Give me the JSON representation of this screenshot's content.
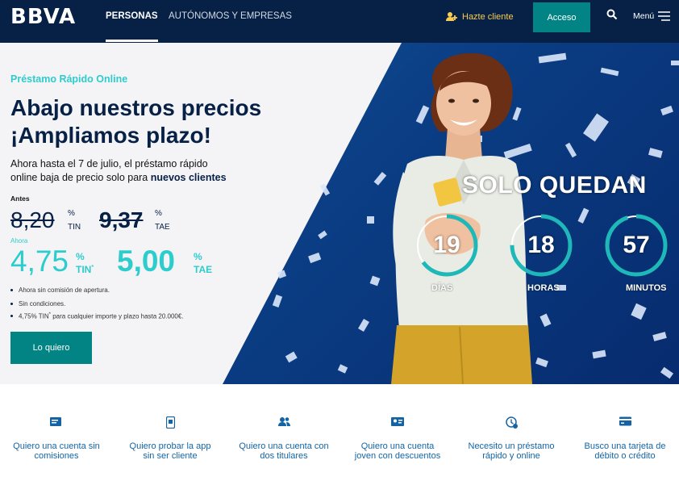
{
  "header": {
    "logo": "BBVA",
    "nav": [
      {
        "label": "PERSONAS",
        "active": true
      },
      {
        "label": "AUTÓNOMOS Y EMPRESAS",
        "active": false
      }
    ],
    "hazte_cliente": "Hazte cliente",
    "acceso": "Acceso",
    "menu": "Menú"
  },
  "hero": {
    "subtitle": "Préstamo Rápido Online",
    "title_line1": "Abajo nuestros precios",
    "title_line2": "¡Ampliamos plazo!",
    "desc_line1": "Ahora hasta el 7 de julio, el préstamo rápido",
    "desc_line2": "online baja de precio solo para",
    "desc_bold": "nuevos clientes",
    "antes_label": "Antes",
    "old_tin": "8,20",
    "old_tae": "9,37",
    "percent": "%",
    "tin_label": "TIN",
    "tae_label": "TAE",
    "ahora_label": "Ahora",
    "new_tin": "4,75",
    "new_tae": "5,00",
    "tin_sup": "*",
    "bullets": [
      "Ahora sin comisión de apertura.",
      "Sin condiciones.",
      "4,75% TIN",
      "*",
      " para cualquier importe y plazo hasta 20.000€."
    ],
    "cta": "Lo quiero",
    "countdown_title": "SOLO QUEDAN",
    "countdown": [
      {
        "value": "19",
        "label": "DÍAS",
        "fraction": 0.65
      },
      {
        "value": "18",
        "label": "HORAS",
        "fraction": 0.75
      },
      {
        "value": "57",
        "label": "MINUTOS",
        "fraction": 0.95
      }
    ]
  },
  "shortcuts": [
    {
      "line1": "Quiero una cuenta sin",
      "line2": "comisiones",
      "icon": "card-icon"
    },
    {
      "line1": "Quiero probar la app",
      "line2": "sin ser cliente",
      "icon": "mobile-icon"
    },
    {
      "line1": "Quiero una cuenta con",
      "line2": "dos titulares",
      "icon": "users-icon"
    },
    {
      "line1": "Quiero una cuenta",
      "line2": "joven con descuentos",
      "icon": "id-card-icon"
    },
    {
      "line1": "Necesito un préstamo",
      "line2": "rápido y online",
      "icon": "clock-money-icon"
    },
    {
      "line1": "Busco una tarjeta de",
      "line2": "débito o crédito",
      "icon": "credit-card-icon"
    }
  ],
  "colors": {
    "navy": "#072146",
    "teal": "#028484",
    "aqua": "#2dcccd",
    "link": "#1464a5",
    "yellow": "#f8cd51"
  }
}
